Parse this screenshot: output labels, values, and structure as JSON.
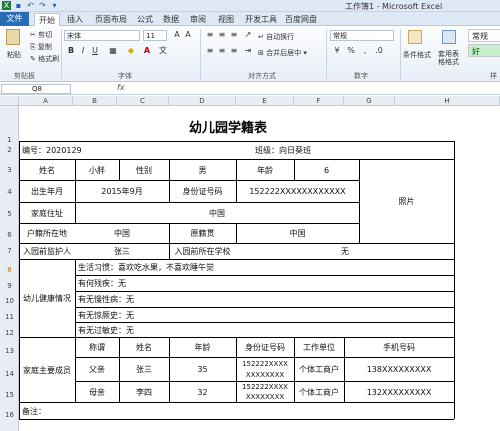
{
  "window": {
    "title": "工作簿1 - Microsoft Excel"
  },
  "tabs": [
    "文件",
    "开始",
    "插入",
    "页面布局",
    "公式",
    "数据",
    "审阅",
    "视图",
    "开发工具",
    "百度网盘"
  ],
  "ribbon": {
    "paste": "粘贴",
    "cut": "剪切",
    "copy": "复制",
    "format_painter": "格式刷",
    "font_name": "宋体",
    "font_size": "11",
    "wrap_text": "自动换行",
    "merge_center": "合并后居中",
    "number_format": "常规",
    "conditional_format": "条件格式",
    "table_format": "套用表格格式",
    "style_normal": "常规",
    "style_good": "好",
    "groups": {
      "clipboard": "剪贴板",
      "font": "字体",
      "alignment": "对齐方式",
      "number": "数字",
      "styles": "样"
    }
  },
  "formula_bar": {
    "name_box": "Q8",
    "fx": "fx"
  },
  "columns": [
    "A",
    "B",
    "C",
    "D",
    "E",
    "F",
    "G",
    "H"
  ],
  "rows": [
    "1",
    "2",
    "3",
    "4",
    "5",
    "6",
    "7",
    "8",
    "9",
    "10",
    "11",
    "12",
    "13",
    "14",
    "15",
    "16"
  ],
  "selected_row": "8",
  "sheet": {
    "title": "幼儿园学籍表",
    "id_label": "编号：2020129",
    "class_label": "班级：向日葵班",
    "name_label": "姓名",
    "name": "小胖",
    "gender_label": "性别",
    "gender": "男",
    "age_label": "年龄",
    "age": "6",
    "dob_label": "出生年月",
    "dob": "2015年9月",
    "idno_label": "身份证号码",
    "idno": "152222XXXXXXXXXXXX",
    "photo": "照片",
    "address_label": "家庭住址",
    "address": "中国",
    "hukou_label": "户籍所在地",
    "hukou": "中国",
    "origin_label": "原籍贯",
    "origin": "中国",
    "guardian_label": "入园前监护人",
    "guardian": "张三",
    "prev_school_label": "入园前所在学校",
    "prev_school": "无",
    "health_label": "幼儿健康情况",
    "health_items": [
      "生活习惯：喜欢吃水果，不喜欢睡午觉",
      "有何残疾：无",
      "有无慢性病：无",
      "有无惊厥史：无",
      "有无过敏史：无"
    ],
    "family_label": "家庭主要成员",
    "family_headers": [
      "称谓",
      "姓名",
      "年龄",
      "身份证号码",
      "工作单位",
      "手机号码"
    ],
    "family": [
      {
        "relation": "父亲",
        "name": "张三",
        "age": "35",
        "idno1": "152222XXXX",
        "idno2": "XXXXXXXX",
        "work": "个体工商户",
        "phone": "138XXXXXXXXX"
      },
      {
        "relation": "母亲",
        "name": "李四",
        "age": "32",
        "idno1": "152222XXXX",
        "idno2": "XXXXXXXX",
        "work": "个体工商户",
        "phone": "132XXXXXXXXX"
      }
    ],
    "remarks_label": "备注："
  }
}
